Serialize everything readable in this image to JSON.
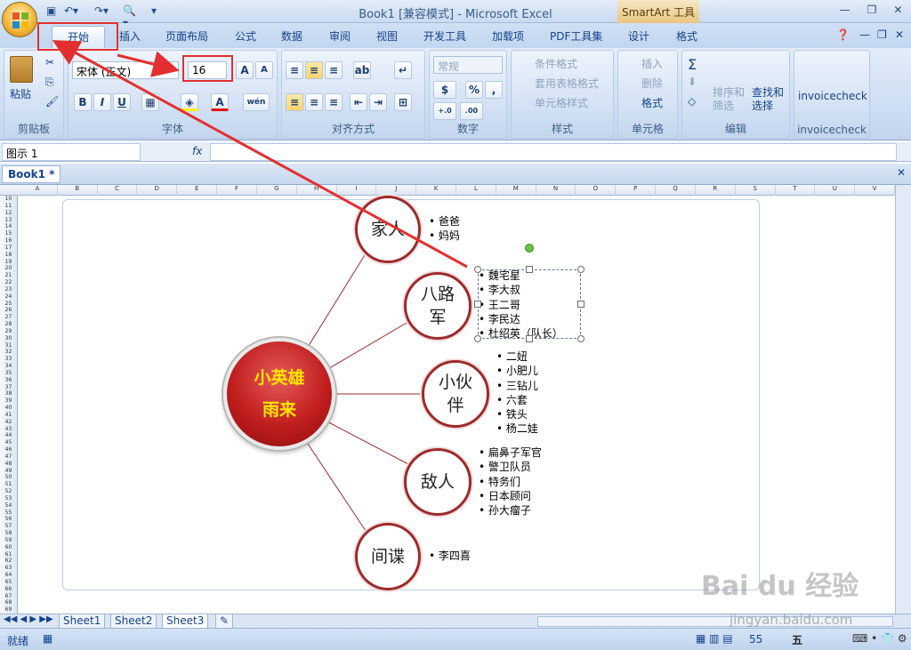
{
  "window": {
    "title": "Book1  [兼容模式] - Microsoft Excel",
    "context_tab": "SmartArt 工具"
  },
  "tabs": [
    "开始",
    "插入",
    "页面布局",
    "公式",
    "数据",
    "审阅",
    "视图",
    "开发工具",
    "加载项",
    "PDF工具集",
    "设计",
    "格式"
  ],
  "ribbon": {
    "clipboard": {
      "paste": "粘贴",
      "label": "剪贴板"
    },
    "font": {
      "name": "宋体 (正文)",
      "size": "16",
      "label": "字体",
      "grow": "A",
      "shrink": "A",
      "bold": "B",
      "italic": "I",
      "underline": "U",
      "color_a": "A",
      "wen": "wén"
    },
    "align": {
      "label": "对齐方式"
    },
    "number": {
      "format": "常规",
      "percent": "%",
      "comma": ",",
      "label": "数字",
      "inc": "+.0 .00",
      "dec": ".00 →.0"
    },
    "styles": {
      "cond": "条件格式",
      "table": "套用表格格式",
      "cell": "单元格样式",
      "label": "样式"
    },
    "cells": {
      "insert": "插入",
      "delete": "删除",
      "format": "格式",
      "label": "单元格"
    },
    "editing": {
      "sum": "Σ",
      "sort": "排序和\n筛选",
      "find": "查找和\n选择",
      "label": "编辑"
    },
    "invoice": {
      "btn": "invoicecheck",
      "label": "invoicecheck"
    }
  },
  "formula_bar": {
    "name_box": "图示  1",
    "fx": "fx",
    "value": ""
  },
  "workbook_tab": "Book1 *",
  "columns": [
    "A",
    "B",
    "C",
    "D",
    "E",
    "F",
    "G",
    "H",
    "I",
    "J",
    "K",
    "L",
    "M",
    "N",
    "O",
    "P",
    "Q",
    "R",
    "S",
    "T",
    "U",
    "V"
  ],
  "rows": [
    "10",
    "11",
    "12",
    "13",
    "14",
    "15",
    "16",
    "17",
    "18",
    "19",
    "20",
    "21",
    "22",
    "23",
    "24",
    "25",
    "26",
    "27",
    "28",
    "29",
    "30",
    "31",
    "32",
    "33",
    "34",
    "35",
    "36",
    "37",
    "38",
    "39",
    "40",
    "41",
    "42",
    "43",
    "44",
    "45",
    "46",
    "47",
    "48",
    "49",
    "50",
    "51",
    "52",
    "53",
    "54",
    "55",
    "56",
    "57",
    "58",
    "59",
    "60",
    "61",
    "62",
    "63",
    "64",
    "65",
    "66",
    "67",
    "68",
    "69"
  ],
  "smartart": {
    "center": {
      "line1": "小英雄",
      "line2": "雨来"
    },
    "nodes": [
      {
        "label": "家人",
        "items": [
          "爸爸",
          "妈妈"
        ]
      },
      {
        "label1": "八路",
        "label2": "军",
        "items": [
          "魏宅星",
          "李大叔",
          "王二哥",
          "李民达",
          "杜绍英（队长）"
        ]
      },
      {
        "label1": "小伙",
        "label2": "伴",
        "items": [
          "二妞",
          "小肥儿",
          "三钻儿",
          "六套",
          "铁头",
          "杨二娃"
        ]
      },
      {
        "label": "敌人",
        "items": [
          "扁鼻子军官",
          "警卫队员",
          "特务们",
          "日本顾问",
          "孙大瘤子"
        ]
      },
      {
        "label": "间谍",
        "items": [
          "李四喜"
        ]
      }
    ]
  },
  "sheets": [
    "Sheet1",
    "Sheet2",
    "Sheet3"
  ],
  "status": {
    "ready": "就绪",
    "zoom": "55",
    "ime": "五"
  },
  "watermark": {
    "text": "Bai du 经验",
    "url": "jingyan.baidu.com"
  },
  "colors": {
    "accent_red": "#e23030",
    "node_border": "#9c2b2b",
    "center_text": "#ffe600"
  }
}
